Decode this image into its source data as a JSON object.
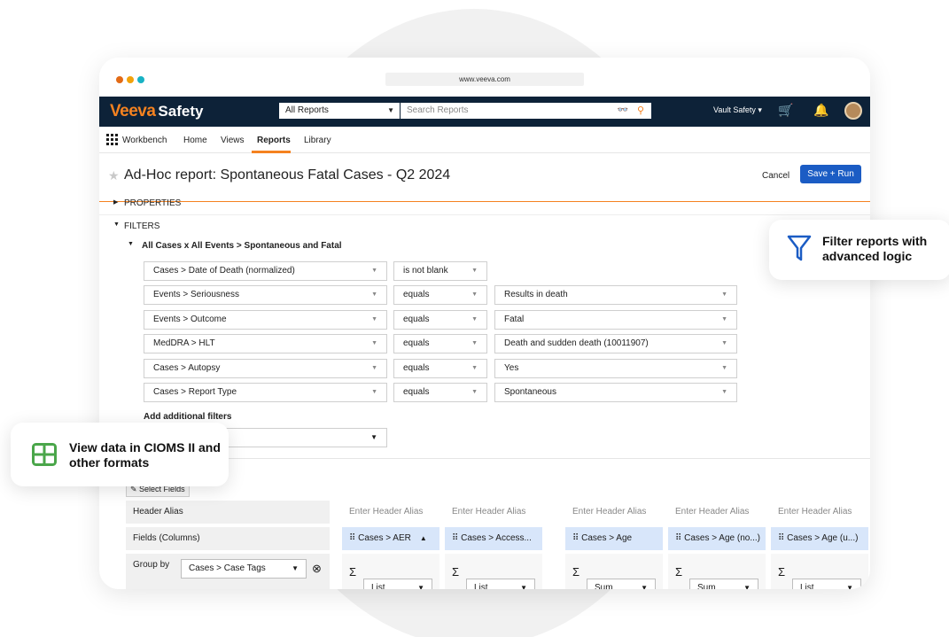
{
  "browser": {
    "url": "www.veeva.com",
    "dot_colors": [
      "#e36b16",
      "#f2a20b",
      "#18b2c4"
    ]
  },
  "appbar": {
    "logo_brand": "Veeva",
    "logo_product": "Safety",
    "scope_select": "All Reports",
    "search_placeholder": "Search Reports",
    "vault_menu": "Vault Safety ▾"
  },
  "nav": {
    "workbench": "Workbench",
    "tabs": [
      "Home",
      "Views",
      "Reports",
      "Library"
    ],
    "active_tab": "Reports"
  },
  "report": {
    "title": "Ad-Hoc report: Spontaneous Fatal Cases - Q2 2024",
    "cancel": "Cancel",
    "save": "Save + Run"
  },
  "sections": {
    "properties": "PROPERTIES",
    "filters": "FILTERS"
  },
  "filter_group": "All Cases x All Events > Spontaneous and Fatal",
  "filters": [
    {
      "field": "Cases > Date of Death (normalized)",
      "operator": "is not blank",
      "value": ""
    },
    {
      "field": "Events > Seriousness",
      "operator": "equals",
      "value": "Results in death"
    },
    {
      "field": "Events > Outcome",
      "operator": "equals",
      "value": "Fatal"
    },
    {
      "field": "MedDRA > HLT",
      "operator": "equals",
      "value": "Death and sudden death (10011907)"
    },
    {
      "field": "Cases > Autopsy",
      "operator": "equals",
      "value": "Yes"
    },
    {
      "field": "Cases > Report Type",
      "operator": "equals",
      "value": "Spontaneous"
    }
  ],
  "add_filters_label": "Add additional filters",
  "select_fields": "Select Fields",
  "columns_grid": {
    "row_labels": {
      "alias": "Header Alias",
      "fields": "Fields (Columns)",
      "group": "Group by"
    },
    "group_by_value": "Cases > Case Tags",
    "alias_placeholder": "Enter Header Alias",
    "fields": [
      "Cases > AER",
      "Cases > Access...",
      "Cases > Age",
      "Cases > Age (no...)",
      "Cases > Age (u...)"
    ],
    "aggregations": [
      "List",
      "List",
      "Sum",
      "Sum",
      "List"
    ]
  },
  "callouts": {
    "filter": "Filter reports with advanced logic",
    "cioms": "View data in CIOMS II and other formats"
  },
  "colors": {
    "accent": "#f58220",
    "navy": "#0d2238",
    "primary": "#1b5cc4",
    "cioms_icon": "#4aa64a",
    "filter_icon": "#1b5cc4"
  }
}
